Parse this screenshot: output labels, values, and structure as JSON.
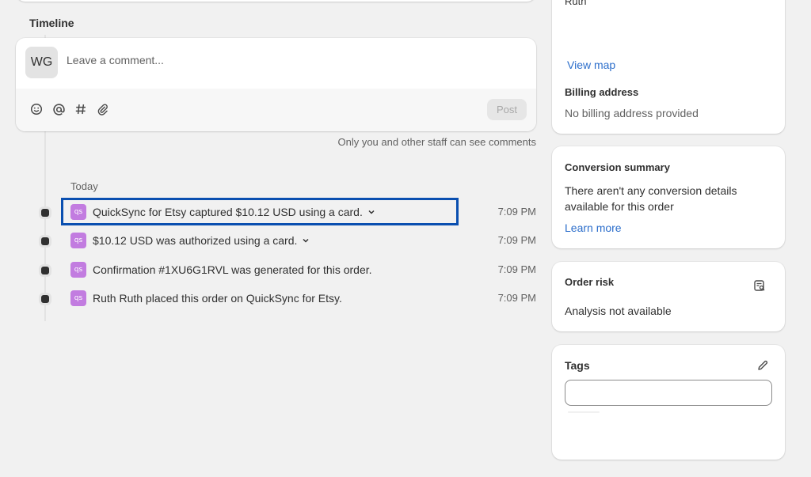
{
  "timeline": {
    "title": "Timeline",
    "comment": {
      "avatar_initials": "WG",
      "placeholder": "Leave a comment...",
      "tools": [
        "emoji-icon",
        "mention-icon",
        "hashtag-icon",
        "attachment-icon"
      ],
      "post_label": "Post"
    },
    "staff_note": "Only you and other staff can see comments",
    "day_label": "Today",
    "events": [
      {
        "message": "QuickSync for Etsy captured $10.12 USD using a card.",
        "expandable": true,
        "time": "7:09 PM",
        "app_icon": "qs"
      },
      {
        "message": "$10.12 USD was authorized using a card.",
        "expandable": true,
        "time": "7:09 PM",
        "app_icon": "qs"
      },
      {
        "message": "Confirmation #1XU6G1RVL was generated for this order.",
        "expandable": false,
        "time": "7:09 PM",
        "app_icon": "qs"
      },
      {
        "message": "Ruth Ruth placed this order on QuickSync for Etsy.",
        "expandable": false,
        "time": "7:09 PM",
        "app_icon": "qs"
      }
    ],
    "highlight_color": "#0a4fb0"
  },
  "sidebar": {
    "address": {
      "name_partial": "Ruth",
      "view_map": "View map",
      "billing_heading": "Billing address",
      "billing_value": "No billing address provided"
    },
    "conversion": {
      "heading": "Conversion summary",
      "text": "There aren't any conversion details available for this order",
      "link": "Learn more"
    },
    "risk": {
      "heading": "Order risk",
      "text": "Analysis not available",
      "icon": "risk-details-icon"
    },
    "tags": {
      "heading": "Tags",
      "edit_icon": "pencil-icon",
      "input_value": ""
    }
  },
  "colors": {
    "link": "#2c6ecb",
    "app_icon_bg": "#c27ce0",
    "page_bg": "#f1f1f1"
  }
}
